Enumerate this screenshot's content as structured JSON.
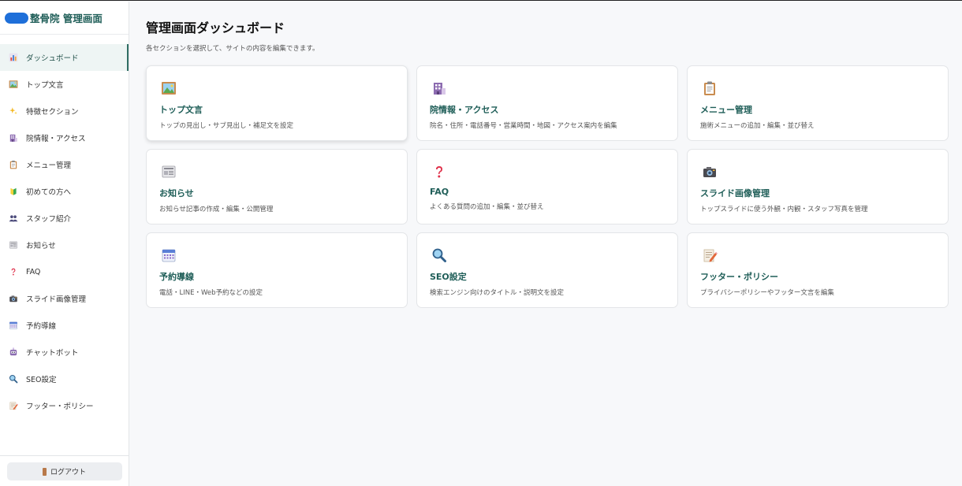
{
  "brand": {
    "title": "整骨院 管理画面"
  },
  "sidebar": {
    "items": [
      {
        "label": "ダッシュボード",
        "icon": "bar-chart-icon",
        "active": true
      },
      {
        "label": "トップ文言",
        "icon": "picture-icon"
      },
      {
        "label": "特徴セクション",
        "icon": "sparkles-icon"
      },
      {
        "label": "院情報・アクセス",
        "icon": "building-icon"
      },
      {
        "label": "メニュー管理",
        "icon": "clipboard-icon"
      },
      {
        "label": "初めての方へ",
        "icon": "beginner-icon"
      },
      {
        "label": "スタッフ紹介",
        "icon": "people-icon"
      },
      {
        "label": "お知らせ",
        "icon": "newspaper-icon"
      },
      {
        "label": "FAQ",
        "icon": "question-icon"
      },
      {
        "label": "スライド画像管理",
        "icon": "camera-icon"
      },
      {
        "label": "予約導線",
        "icon": "calendar-icon"
      },
      {
        "label": "チャットボット",
        "icon": "robot-icon"
      },
      {
        "label": "SEO設定",
        "icon": "magnifier-icon"
      },
      {
        "label": "フッター・ポリシー",
        "icon": "memo-icon"
      }
    ],
    "logout_label": "ログアウト"
  },
  "main": {
    "title": "管理画面ダッシュボード",
    "subtitle": "各セクションを選択して、サイトの内容を編集できます。",
    "cards": [
      {
        "title": "トップ文言",
        "desc": "トップの見出し・サブ見出し・補足文を設定",
        "icon": "picture-icon"
      },
      {
        "title": "院情報・アクセス",
        "desc": "院名・住所・電話番号・営業時間・地図・アクセス案内を編集",
        "icon": "building-icon"
      },
      {
        "title": "メニュー管理",
        "desc": "施術メニューの追加・編集・並び替え",
        "icon": "clipboard-icon"
      },
      {
        "title": "お知らせ",
        "desc": "お知らせ記事の作成・編集・公開管理",
        "icon": "newspaper-icon"
      },
      {
        "title": "FAQ",
        "desc": "よくある質問の追加・編集・並び替え",
        "icon": "question-icon"
      },
      {
        "title": "スライド画像管理",
        "desc": "トップスライドに使う外観・内観・スタッフ写真を管理",
        "icon": "camera-icon"
      },
      {
        "title": "予約導線",
        "desc": "電話・LINE・Web予約などの設定",
        "icon": "calendar-icon"
      },
      {
        "title": "SEO設定",
        "desc": "検索エンジン向けのタイトル・説明文を設定",
        "icon": "magnifier-icon"
      },
      {
        "title": "フッター・ポリシー",
        "desc": "プライバシーポリシーやフッター文言を編集",
        "icon": "memo-icon"
      }
    ]
  },
  "colors": {
    "accent": "#1f5e58",
    "active_bg": "#eef5f4",
    "brand_mask": "#1e6fd9"
  }
}
